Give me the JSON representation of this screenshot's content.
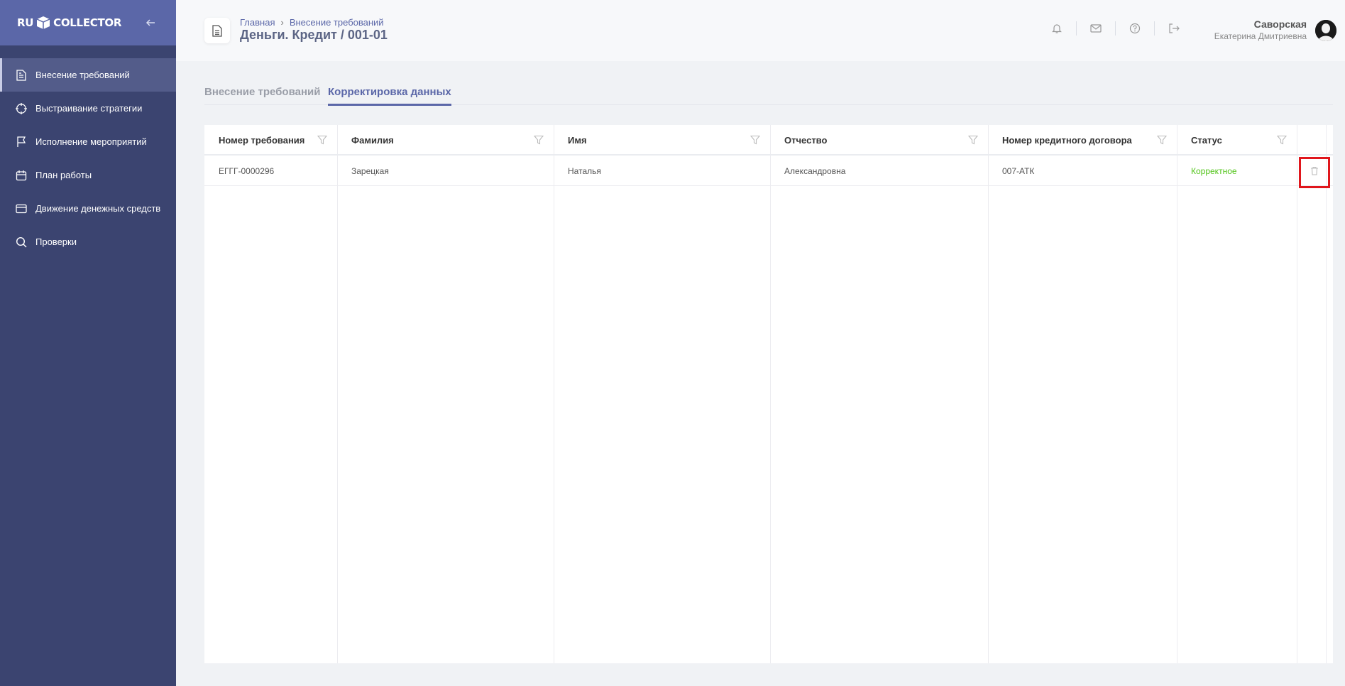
{
  "sidebar": {
    "logo_left": "RU",
    "logo_right": "COLLECTOR",
    "collapse_icon": "arrow-left-icon",
    "items": [
      {
        "label": "Внесение требований",
        "icon": "document-icon",
        "active": true
      },
      {
        "label": "Выстраивание стратегии",
        "icon": "crosshair-icon",
        "active": false
      },
      {
        "label": "Исполнение мероприятий",
        "icon": "flag-icon",
        "active": false
      },
      {
        "label": "План работы",
        "icon": "calendar-icon",
        "active": false
      },
      {
        "label": "Движение денежных средств",
        "icon": "credit-card-icon",
        "active": false
      },
      {
        "label": "Проверки",
        "icon": "search-icon",
        "active": false
      }
    ]
  },
  "header": {
    "breadcrumb": [
      "Главная",
      "Внесение требований"
    ],
    "breadcrumb_sep": "›",
    "title": "Деньги. Кредит / 001-01",
    "icons": [
      "bell-icon",
      "mail-icon",
      "help-icon",
      "logout-icon"
    ],
    "user": {
      "last_name": "Саворская",
      "first_name": "Екатерина Дмитриевна"
    }
  },
  "tabs": [
    {
      "label": "Внесение требований",
      "active": false
    },
    {
      "label": "Корректировка данных",
      "active": true
    }
  ],
  "table": {
    "columns": [
      "Номер требования",
      "Фамилия",
      "Имя",
      "Отчество",
      "Номер кредитного договора",
      "Статус"
    ],
    "rows": [
      [
        "ЕГГГ-0000296",
        "Зарецкая",
        "Наталья",
        "Александровна",
        "007-АТК",
        "Корректное"
      ]
    ]
  },
  "colors": {
    "sidebar_bg": "#3b4470",
    "sidebar_head": "#5b67a8",
    "accent": "#5b67a8",
    "status_ok": "#52c41a",
    "highlight": "#e0161c"
  }
}
